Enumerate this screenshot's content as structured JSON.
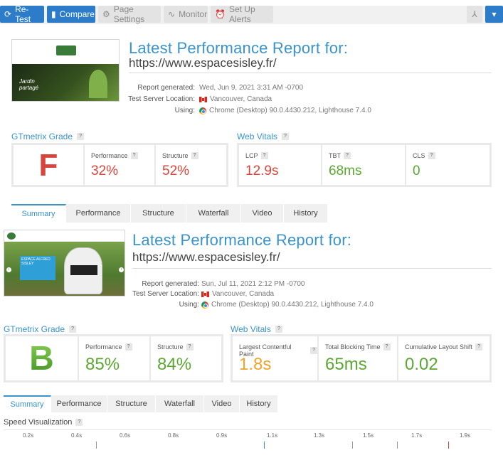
{
  "toolbar": {
    "retest": "Re-Test",
    "compare": "Compare",
    "page_settings": "Page Settings",
    "monitor": "Monitor",
    "setup_alerts": "Set Up Alerts"
  },
  "report1": {
    "title": "Latest Performance Report for:",
    "url": "https://www.espacesisley.fr/",
    "generated_label": "Report generated:",
    "generated_value": "Wed, Jun 9, 2021 3:31 AM -0700",
    "server_label": "Test Server Location:",
    "server_value": "Vancouver, Canada",
    "using_label": "Using:",
    "using_value": "Chrome (Desktop) 90.0.4430.212, Lighthouse 7.4.0",
    "thumb_text": "Jardin partagé",
    "grade_heading": "GTmetrix Grade",
    "grade": "F",
    "perf_label": "Performance",
    "perf_value": "32%",
    "struct_label": "Structure",
    "struct_value": "52%",
    "vitals_heading": "Web Vitals",
    "lcp_label": "LCP",
    "lcp_value": "12.9s",
    "tbt_label": "TBT",
    "tbt_value": "68ms",
    "cls_label": "CLS",
    "cls_value": "0",
    "tabs": [
      "Summary",
      "Performance",
      "Structure",
      "Waterfall",
      "Video",
      "History"
    ]
  },
  "report2": {
    "title": "Latest Performance Report for:",
    "url": "https://www.espacesisley.fr/",
    "generated_label": "Report generated:",
    "generated_value": "Sun, Jul 11, 2021 2:12 PM -0700",
    "server_label": "Test Server Location:",
    "server_value": "Vancouver, Canada",
    "using_label": "Using:",
    "using_value": "Chrome (Desktop) 90.0.4430.212, Lighthouse 7.4.0",
    "thumb_banner": "ESPACE ALFRED SISLEY",
    "grade_heading": "GTmetrix Grade",
    "grade": "B",
    "perf_label": "Performance",
    "perf_value": "85%",
    "struct_label": "Structure",
    "struct_value": "84%",
    "vitals_heading": "Web Vitals",
    "lcp_label": "Largest Contentful Paint",
    "lcp_value": "1.8s",
    "tbt_label": "Total Blocking Time",
    "tbt_value": "65ms",
    "cls_label": "Cumulative Layout Shift",
    "cls_value": "0.02",
    "tabs": [
      "Summary",
      "Performance",
      "Structure",
      "Waterfall",
      "Video",
      "History"
    ]
  },
  "speed": {
    "heading": "Speed Visualization",
    "ticks": [
      "0.2s",
      "0.4s",
      "0.6s",
      "0.8s",
      "0.9s",
      "1.1s",
      "1.3s",
      "1.5s",
      "1.7s",
      "1.9s"
    ]
  },
  "colors": {
    "accent": "#3a93c9",
    "primary_button": "#2d7cc9",
    "grade_f": "#d9453c",
    "grade_b": "#5aa832",
    "good": "#5aa832",
    "warn": "#f0a32b",
    "bad": "#d9453c"
  }
}
